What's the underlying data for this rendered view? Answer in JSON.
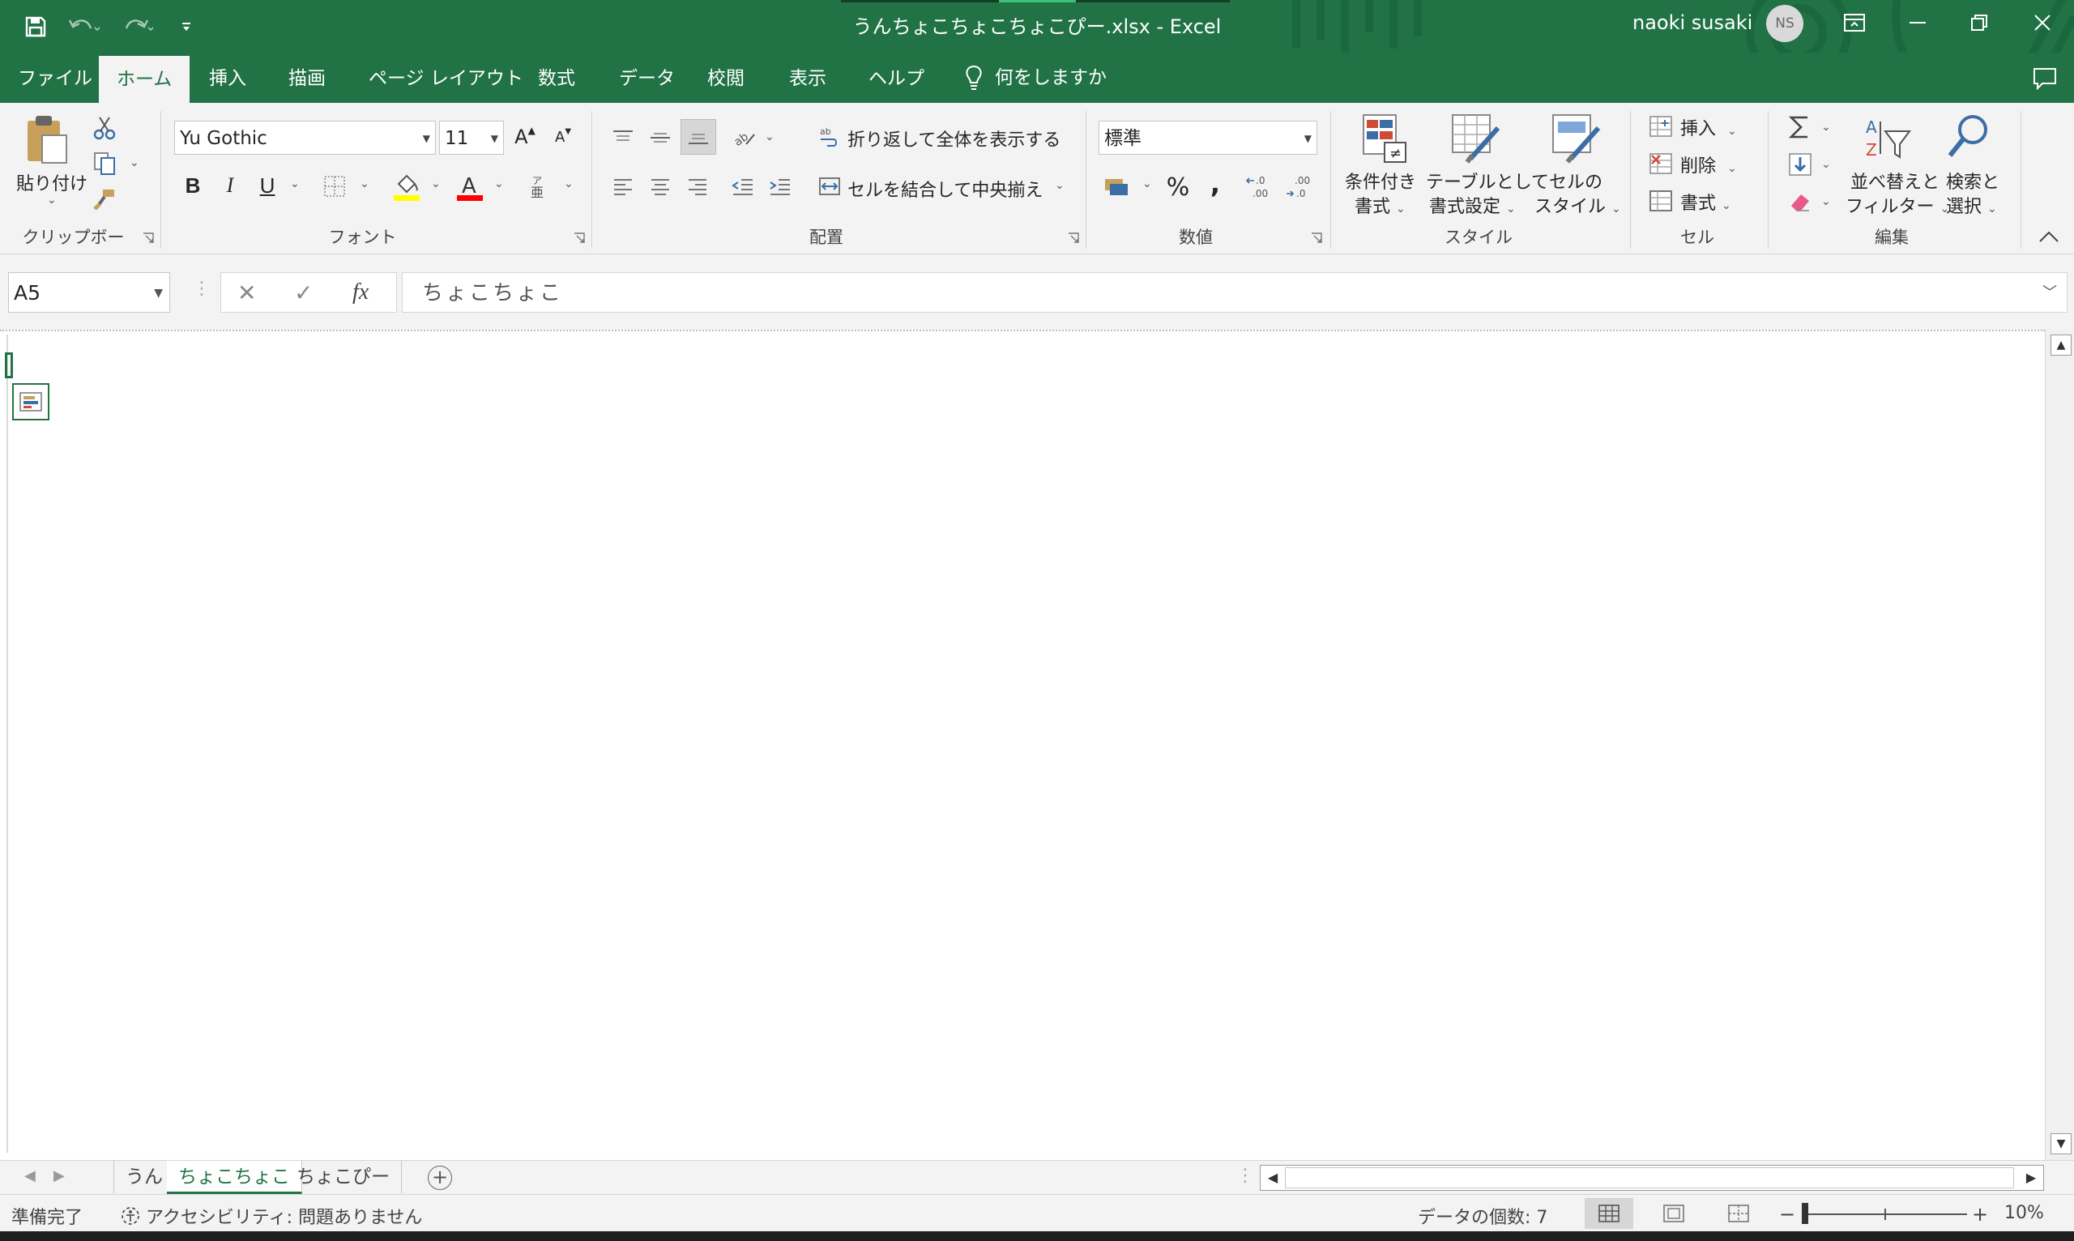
{
  "window": {
    "title": "うんちょこちょこちょこぴー.xlsx  -  Excel",
    "user_name": "naoki susaki",
    "user_initials": "NS",
    "accent_color": "#217346"
  },
  "quick_access": {
    "save_icon": "save-icon",
    "undo_icon": "undo-icon",
    "redo_icon": "redo-icon",
    "customize_icon": "customize-qat-icon"
  },
  "ribbon_tabs": [
    {
      "label": "ファイル"
    },
    {
      "label": "ホーム",
      "active": true
    },
    {
      "label": "挿入"
    },
    {
      "label": "描画"
    },
    {
      "label": "ページ レイアウト"
    },
    {
      "label": "数式"
    },
    {
      "label": "データ"
    },
    {
      "label": "校閲"
    },
    {
      "label": "表示"
    },
    {
      "label": "ヘルプ"
    }
  ],
  "tell_me": "何をしますか",
  "ribbon": {
    "clipboard": {
      "label": "クリップボード",
      "paste_label": "貼り付け",
      "paste_dd": "⌄"
    },
    "font": {
      "label": "フォント",
      "font_name": "Yu Gothic",
      "font_size": "11",
      "bold": "B",
      "italic": "I",
      "underline": "U",
      "grow": "A",
      "shrink": "A"
    },
    "alignment": {
      "label": "配置",
      "wrap_text": "折り返して全体を表示する",
      "merge_center": "セルを結合して中央揃え"
    },
    "number": {
      "label": "数値",
      "format": "標準",
      "percent": "%",
      "comma": ","
    },
    "styles": {
      "label": "スタイル",
      "conditional_1": "条件付き",
      "conditional_2": "書式",
      "table_1": "テーブルとして",
      "table_2": "書式設定",
      "cell_1": "セルの",
      "cell_2": "スタイル"
    },
    "cells": {
      "label": "セル",
      "insert": "挿入",
      "delete": "削除",
      "format": "書式"
    },
    "editing": {
      "label": "編集",
      "sort_1": "並べ替えと",
      "sort_2": "フィルター",
      "find_1": "検索と",
      "find_2": "選択"
    }
  },
  "formula_bar": {
    "name_box": "A5",
    "content": "ちょこちょこ",
    "fx": "fx"
  },
  "sheets": [
    {
      "name": "うん"
    },
    {
      "name": "ちょこちょこ",
      "active": true
    },
    {
      "name": "ちょこぴー"
    }
  ],
  "status": {
    "ready": "準備完了",
    "accessibility": "アクセシビリティ: 問題ありません",
    "count": "データの個数: 7",
    "zoom": "10%",
    "zoom_level": 0.1
  }
}
